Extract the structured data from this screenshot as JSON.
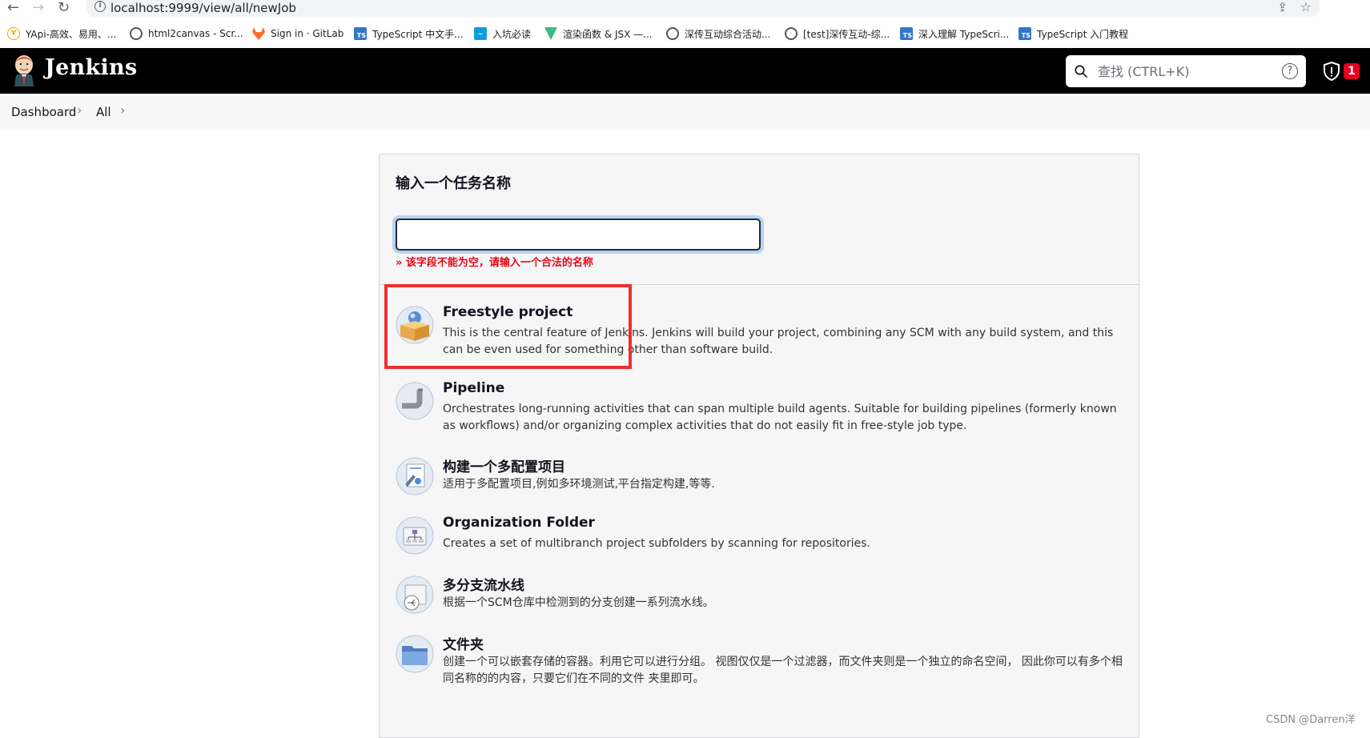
{
  "browser": {
    "url": "localhost:9999/view/all/newJob",
    "bookmarks": [
      {
        "label": "YApi-高效、易用、...",
        "icon": "yapi-icon"
      },
      {
        "label": "html2canvas - Scr...",
        "icon": "globe-icon"
      },
      {
        "label": "Sign in · GitLab",
        "icon": "gitlab-icon"
      },
      {
        "label": "TypeScript 中文手...",
        "icon": "typescript-icon"
      },
      {
        "label": "入坑必读",
        "icon": "wave-icon"
      },
      {
        "label": "渲染函数 & JSX —...",
        "icon": "vue-icon"
      },
      {
        "label": "深传互动综合活动...",
        "icon": "globe-icon"
      },
      {
        "label": "[test]深传互动-综...",
        "icon": "globe-icon"
      },
      {
        "label": "深入理解 TypeScri...",
        "icon": "typescript-icon"
      },
      {
        "label": "TypeScript 入门教程",
        "icon": "typescript-icon"
      }
    ]
  },
  "header": {
    "brand": "Jenkins",
    "search_placeholder": "查找 (CTRL+K)",
    "help_glyph": "?",
    "security_count": "1"
  },
  "breadcrumb": [
    "Dashboard",
    "All"
  ],
  "form": {
    "name_label": "输入一个任务名称",
    "name_value": "",
    "error": "» 该字段不能为空，请输入一个合法的名称"
  },
  "job_types": [
    {
      "title": "Freestyle project",
      "desc": "This is the central feature of Jenkins. Jenkins will build your project, combining any SCM with any build system, and this can be even used for something other than software build.",
      "icon": "freestyle-box-icon"
    },
    {
      "title": "Pipeline",
      "desc": "Orchestrates long-running activities that can span multiple build agents. Suitable for building pipelines (formerly known as workflows) and/or organizing complex activities that do not easily fit in free-style job type.",
      "icon": "pipeline-icon"
    },
    {
      "title": "构建一个多配置项目",
      "desc": "适用于多配置项目,例如多环境测试,平台指定构建,等等.",
      "icon": "multi-config-icon"
    },
    {
      "title": "Organization Folder",
      "desc": "Creates a set of multibranch project subfolders by scanning for repositories.",
      "icon": "organization-folder-icon"
    },
    {
      "title": "多分支流水线",
      "desc": "根据一个SCM仓库中检测到的分支创建一系列流水线。",
      "icon": "multibranch-icon"
    },
    {
      "title": "文件夹",
      "desc": "创建一个可以嵌套存储的容器。利用它可以进行分组。 视图仅仅是一个过滤器，而文件夹则是一个独立的命名空间， 因此你可以有多个相同名称的的内容，只要它们在不同的文件 夹里即可。",
      "icon": "folder-icon"
    }
  ],
  "watermark": "CSDN @Darren洋",
  "colors": {
    "header_bg": "#000000",
    "error": "#e00b1b",
    "highlight": "#ef2d2d",
    "badge": "#e6001f"
  }
}
